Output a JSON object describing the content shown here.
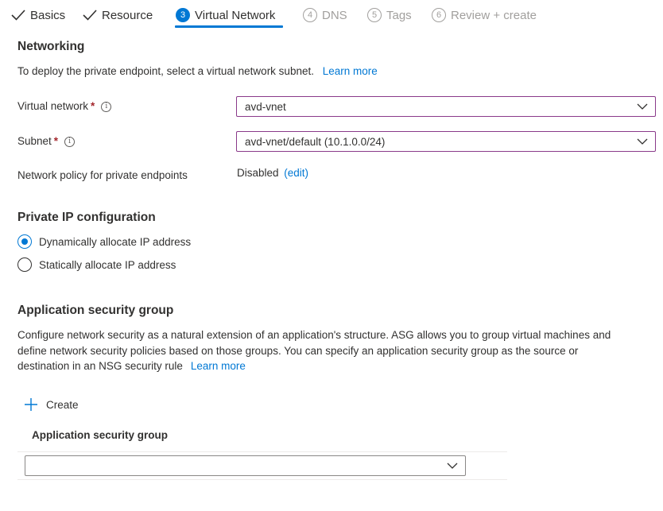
{
  "tabs": [
    {
      "label": "Basics",
      "state": "done"
    },
    {
      "label": "Resource",
      "state": "done"
    },
    {
      "num": "3",
      "label": "Virtual Network",
      "state": "active"
    },
    {
      "num": "4",
      "label": "DNS",
      "state": "disabled"
    },
    {
      "num": "5",
      "label": "Tags",
      "state": "disabled"
    },
    {
      "num": "6",
      "label": "Review + create",
      "state": "disabled"
    }
  ],
  "networking": {
    "heading": "Networking",
    "description": "To deploy the private endpoint, select a virtual network subnet.",
    "learn_more": "Learn more",
    "virtual_network_label": "Virtual network",
    "virtual_network_value": "avd-vnet",
    "subnet_label": "Subnet",
    "subnet_value": "avd-vnet/default (10.1.0.0/24)",
    "required_mark": "*",
    "info_glyph": "i",
    "policy_label": "Network policy for private endpoints",
    "policy_value": "Disabled",
    "policy_edit": "(edit)"
  },
  "private_ip": {
    "heading": "Private IP configuration",
    "options": [
      {
        "label": "Dynamically allocate IP address",
        "selected": true
      },
      {
        "label": "Statically allocate IP address",
        "selected": false
      }
    ]
  },
  "asg": {
    "heading": "Application security group",
    "description_line1": "Configure network security as a natural extension of an application's structure. ASG allows you to group virtual machines and",
    "description_line2": "define network security policies based on those groups. You can specify an application security group as the source or",
    "description_line3": "destination in an NSG security rule",
    "learn_more": "Learn more",
    "create_label": "Create",
    "column_header": "Application security group",
    "select_value": ""
  },
  "colors": {
    "accent": "#0078d4",
    "required": "#a4262c",
    "focused_border": "#8a3a8a",
    "disabled_text": "#a19f9d"
  }
}
